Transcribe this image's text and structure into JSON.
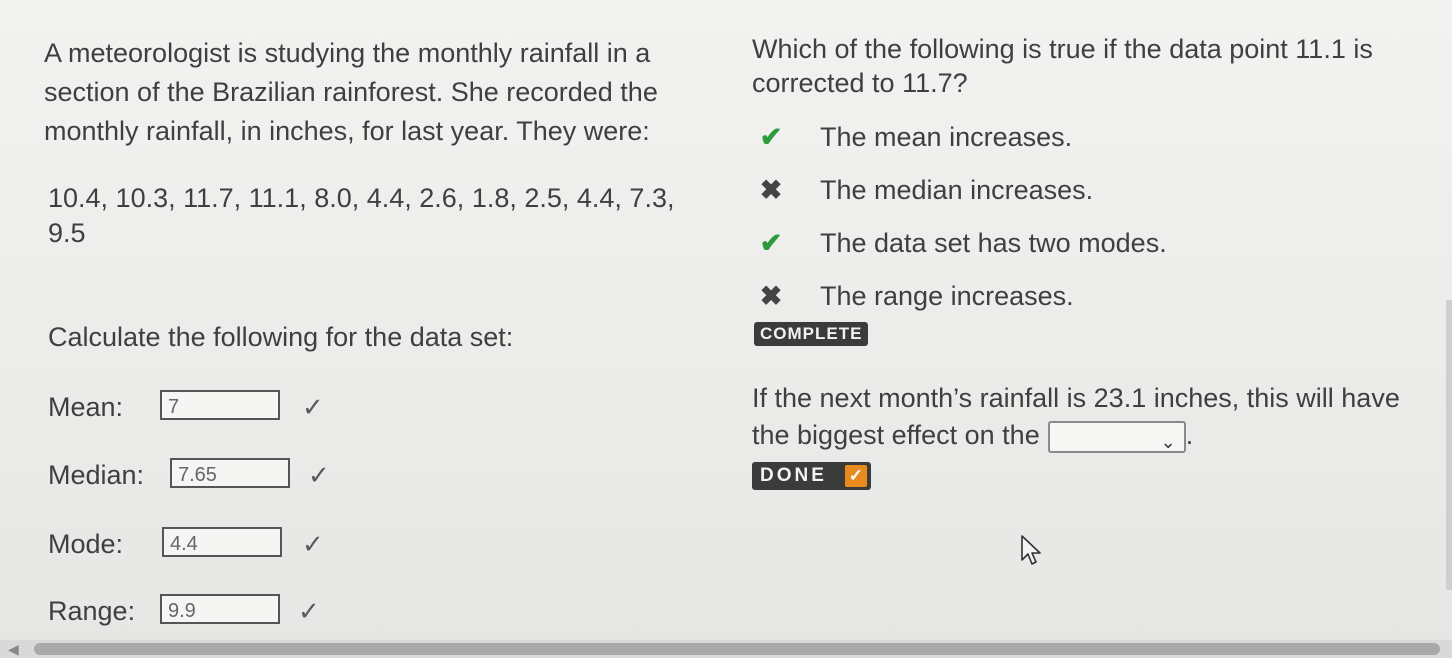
{
  "left": {
    "intro": "A meteorologist is studying the monthly rainfall in a section of the Brazilian rainforest. She recorded the monthly rainfall, in inches, for last year. They were:",
    "data_list": "10.4, 10.3, 11.7, 11.1, 8.0, 4.4, 2.6, 1.8, 2.5, 4.4, 7.3, 9.5",
    "calc_heading": "Calculate the following for the data set:",
    "rows": [
      {
        "label": "Mean:",
        "value": "7",
        "check": "✓"
      },
      {
        "label": "Median:",
        "value": "7.65",
        "check": "✓"
      },
      {
        "label": "Mode:",
        "value": "4.4",
        "check": "✓"
      },
      {
        "label": "Range:",
        "value": "9.9",
        "check": "✓"
      }
    ]
  },
  "right": {
    "question": "Which of the following is true if the data point 11.1 is corrected to 11.7?",
    "options": [
      {
        "text": "The mean increases.",
        "mark": "✔",
        "correct": true
      },
      {
        "text": "The median increases.",
        "mark": "✖",
        "correct": false
      },
      {
        "text": "The data set has two modes.",
        "mark": "✔",
        "correct": true
      },
      {
        "text": "The range increases.",
        "mark": "✖",
        "correct": false
      }
    ],
    "complete_badge": "COMPLETE",
    "q2_text": "If the next month’s rainfall is 23.1 inches, this will have the biggest effect on the",
    "q2_select_value": "",
    "q2_period": ".",
    "done_badge": "DONE",
    "done_check": "✓"
  },
  "icons": {
    "select_chevron": "chevron-down-icon",
    "cursor": "mouse-pointer-icon",
    "scroll_left": "scroll-left-arrow-icon"
  },
  "colors": {
    "correct": "#2e9b3a",
    "incorrect": "#444444",
    "done_check": "#e88a1e",
    "badge_bg": "#3b3b3b"
  }
}
